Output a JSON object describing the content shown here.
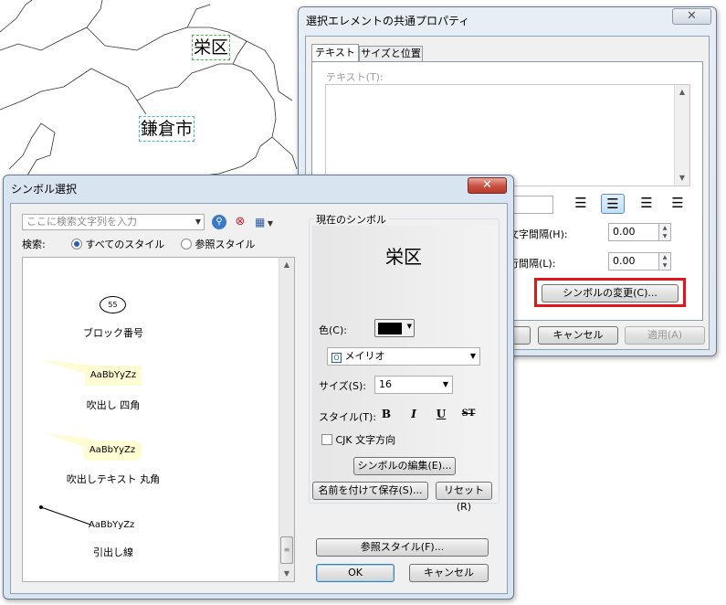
{
  "map": {
    "label_sakae": "栄区",
    "label_kamakura": "鎌倉市"
  },
  "props_window": {
    "title": "選択エレメントの共通プロパティ",
    "close": "✕",
    "tab_text": "テキスト",
    "tab_size_position": "サイズと位置",
    "text_label": "テキスト(T):",
    "char_spacing_label": "文字間隔(H):",
    "char_spacing_value": "0.00",
    "line_spacing_label": "行間隔(L):",
    "line_spacing_value": "0.00",
    "change_symbol_button": "シンボルの変更(C)...",
    "ok_button": "",
    "cancel_button": "キャンセル",
    "apply_button": "適用(A)"
  },
  "symbol_window": {
    "title": "シンボル選択",
    "close": "✕",
    "search_placeholder": "ここに検索文字列を入力",
    "search_label": "検索:",
    "radio_all_styles": "すべてのスタイル",
    "radio_ref_styles": "参照スタイル",
    "symbols": [
      {
        "name": "ブロック番号",
        "preview": "55"
      },
      {
        "name": "吹出し 四角",
        "preview": "AaBbYyZz"
      },
      {
        "name": "吹出しテキスト 丸角",
        "preview": "AaBbYyZz"
      },
      {
        "name": "引出し線",
        "preview": "AaBbYyZz"
      }
    ],
    "current_symbol_group": "現在のシンボル",
    "current_symbol_preview": "栄区",
    "color_label": "色(C):",
    "color_value": "#000000",
    "font_value": "メイリオ",
    "size_label": "サイズ(S):",
    "size_value": "16",
    "style_label": "スタイル(T):",
    "style_bold": "B",
    "style_italic": "I",
    "style_underline": "U",
    "style_strike": "ST",
    "cjk_label": "CJK 文字方向",
    "edit_symbol_button": "シンボルの編集(E)...",
    "save_as_button": "名前を付けて保存(S)...",
    "reset_button": "リセット(R)",
    "ref_styles_button": "参照スタイル(F)...",
    "ok_button": "OK",
    "cancel_button": "キャンセル"
  },
  "colors": {
    "highlight_box": "#e0161d",
    "titlebar": "#d9e4f1"
  }
}
